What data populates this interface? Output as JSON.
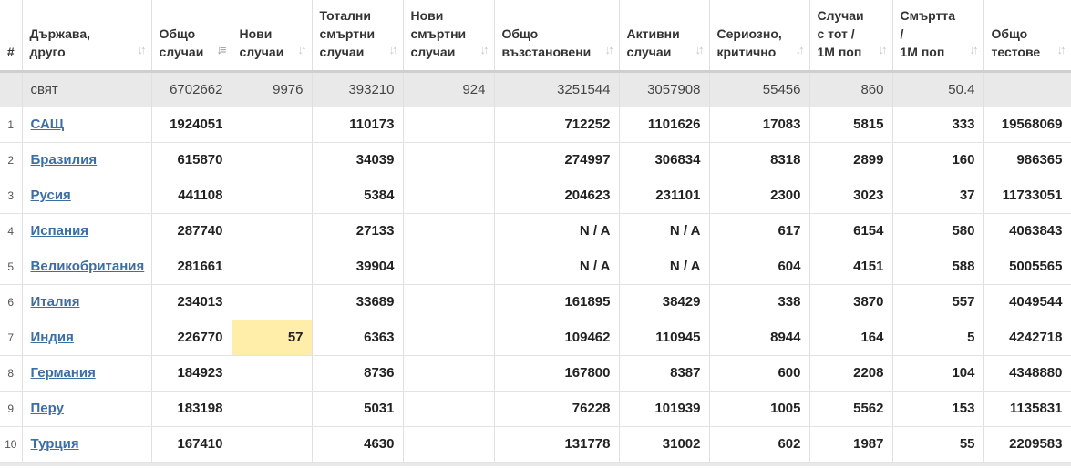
{
  "headers": [
    {
      "key": "idx",
      "label": "#"
    },
    {
      "key": "country",
      "label": "Държава,\nдруго"
    },
    {
      "key": "total_cases",
      "label": "Общо\nслучаи"
    },
    {
      "key": "new_cases",
      "label": "Нови\nслучаи"
    },
    {
      "key": "total_deaths",
      "label": "Тотални\nсмъртни\nслучаи"
    },
    {
      "key": "new_deaths",
      "label": "Нови\nсмъртни\nслучаи"
    },
    {
      "key": "total_recovered",
      "label": "Общо\nвъзстановени"
    },
    {
      "key": "active",
      "label": "Активни\nслучаи"
    },
    {
      "key": "serious",
      "label": "Сериозно,\nкритично"
    },
    {
      "key": "cases_per_1m",
      "label": "Случаи\nс тот /\n1M поп"
    },
    {
      "key": "deaths_per_1m",
      "label": "Смъртта\n/\n1M поп"
    },
    {
      "key": "total_tests",
      "label": "Общо\nтестове"
    }
  ],
  "world": {
    "country": "свят",
    "total_cases": "6702662",
    "new_cases": "9976",
    "total_deaths": "393210",
    "new_deaths": "924",
    "total_recovered": "3251544",
    "active": "3057908",
    "serious": "55456",
    "cases_per_1m": "860",
    "deaths_per_1m": "50.4",
    "total_tests": ""
  },
  "rows": [
    {
      "idx": "1",
      "country": "САЩ",
      "total_cases": "1924051",
      "new_cases": "",
      "total_deaths": "110173",
      "new_deaths": "",
      "total_recovered": "712252",
      "active": "1101626",
      "serious": "17083",
      "cases_per_1m": "5815",
      "deaths_per_1m": "333",
      "total_tests": "19568069"
    },
    {
      "idx": "2",
      "country": "Бразилия",
      "total_cases": "615870",
      "new_cases": "",
      "total_deaths": "34039",
      "new_deaths": "",
      "total_recovered": "274997",
      "active": "306834",
      "serious": "8318",
      "cases_per_1m": "2899",
      "deaths_per_1m": "160",
      "total_tests": "986365"
    },
    {
      "idx": "3",
      "country": "Русия",
      "total_cases": "441108",
      "new_cases": "",
      "total_deaths": "5384",
      "new_deaths": "",
      "total_recovered": "204623",
      "active": "231101",
      "serious": "2300",
      "cases_per_1m": "3023",
      "deaths_per_1m": "37",
      "total_tests": "11733051"
    },
    {
      "idx": "4",
      "country": "Испания",
      "total_cases": "287740",
      "new_cases": "",
      "total_deaths": "27133",
      "new_deaths": "",
      "total_recovered": "N / A",
      "active": "N / A",
      "serious": "617",
      "cases_per_1m": "6154",
      "deaths_per_1m": "580",
      "total_tests": "4063843"
    },
    {
      "idx": "5",
      "country": "Великобритания",
      "total_cases": "281661",
      "new_cases": "",
      "total_deaths": "39904",
      "new_deaths": "",
      "total_recovered": "N / A",
      "active": "N / A",
      "serious": "604",
      "cases_per_1m": "4151",
      "deaths_per_1m": "588",
      "total_tests": "5005565"
    },
    {
      "idx": "6",
      "country": "Италия",
      "total_cases": "234013",
      "new_cases": "",
      "total_deaths": "33689",
      "new_deaths": "",
      "total_recovered": "161895",
      "active": "38429",
      "serious": "338",
      "cases_per_1m": "3870",
      "deaths_per_1m": "557",
      "total_tests": "4049544"
    },
    {
      "idx": "7",
      "country": "Индия",
      "total_cases": "226770",
      "new_cases": "57",
      "total_deaths": "6363",
      "new_deaths": "",
      "total_recovered": "109462",
      "active": "110945",
      "serious": "8944",
      "cases_per_1m": "164",
      "deaths_per_1m": "5",
      "total_tests": "4242718"
    },
    {
      "idx": "8",
      "country": "Германия",
      "total_cases": "184923",
      "new_cases": "",
      "total_deaths": "8736",
      "new_deaths": "",
      "total_recovered": "167800",
      "active": "8387",
      "serious": "600",
      "cases_per_1m": "2208",
      "deaths_per_1m": "104",
      "total_tests": "4348880"
    },
    {
      "idx": "9",
      "country": "Перу",
      "total_cases": "183198",
      "new_cases": "",
      "total_deaths": "5031",
      "new_deaths": "",
      "total_recovered": "76228",
      "active": "101939",
      "serious": "1005",
      "cases_per_1m": "5562",
      "deaths_per_1m": "153",
      "total_tests": "1135831"
    },
    {
      "idx": "10",
      "country": "Турция",
      "total_cases": "167410",
      "new_cases": "",
      "total_deaths": "4630",
      "new_deaths": "",
      "total_recovered": "131778",
      "active": "31002",
      "serious": "602",
      "cases_per_1m": "1987",
      "deaths_per_1m": "55",
      "total_tests": "2209583"
    }
  ],
  "colors": {
    "link": "#3b6ea5",
    "world_row_bg": "#e9e9e9",
    "new_cases_highlight": "#ffeeaa"
  },
  "icons": {
    "sort": "sort-arrows-icon",
    "sort_active": "sort-desc-icon"
  }
}
